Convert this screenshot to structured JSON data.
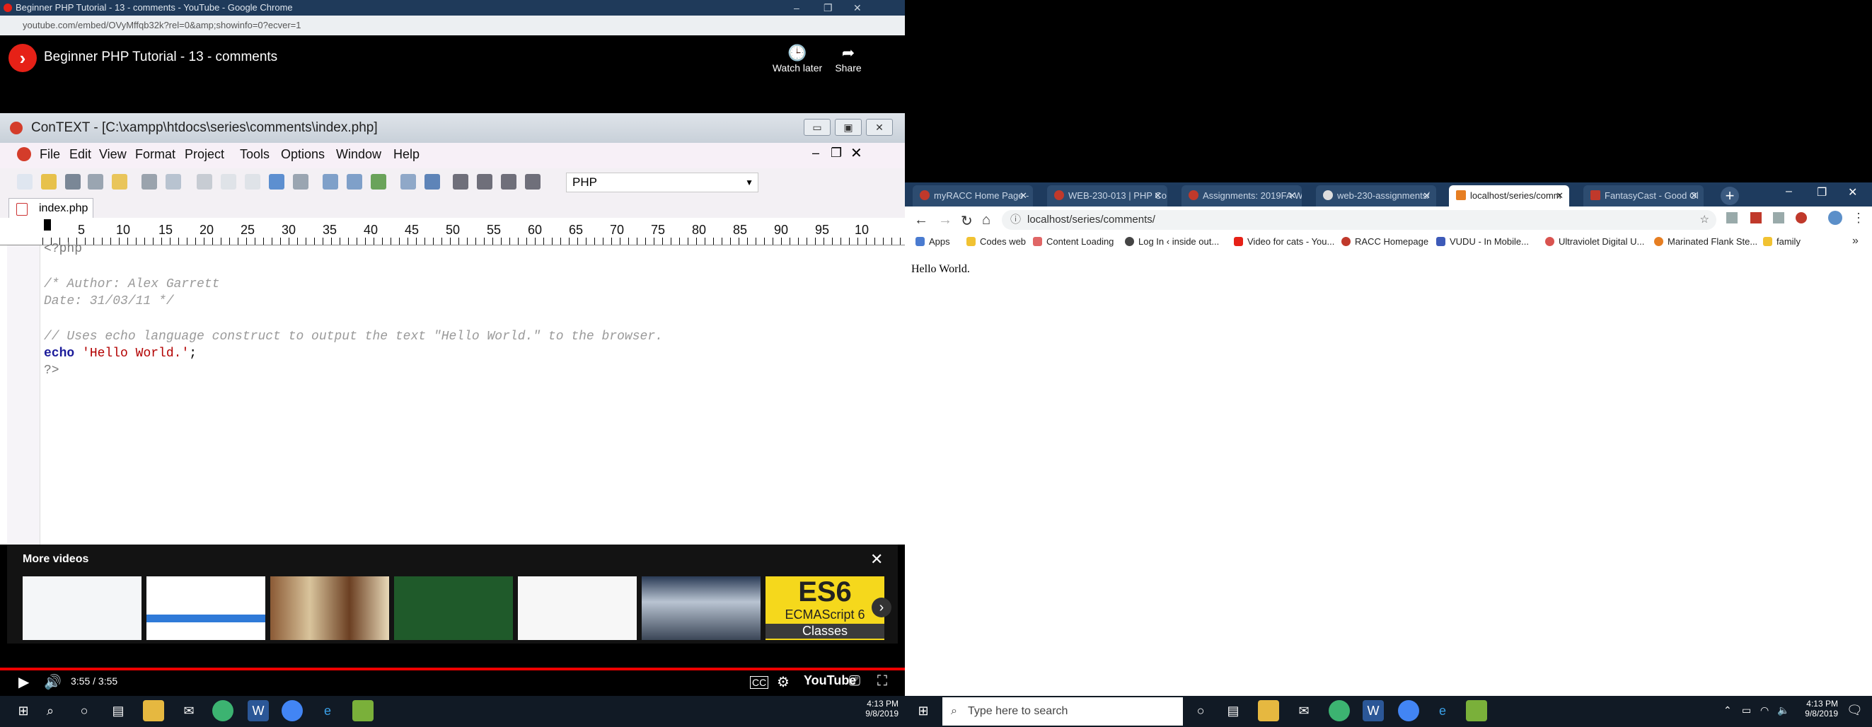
{
  "left_window": {
    "title": "Beginner PHP Tutorial - 13 - comments - YouTube - Google Chrome",
    "url": "youtube.com/embed/OVyMffqb32k?rel=0&amp;showinfo=0?ecver=1",
    "video_title": "Beginner PHP Tutorial - 13 - comments",
    "watch_later": "Watch later",
    "share": "Share"
  },
  "context": {
    "title": "ConTEXT - [C:\\xampp\\htdocs\\series\\comments\\index.php]",
    "menu": [
      "File",
      "Edit",
      "View",
      "Format",
      "Project",
      "Tools",
      "Options",
      "Window",
      "Help"
    ],
    "language": "PHP",
    "tab": "index.php",
    "ruler": [
      "5",
      "10",
      "15",
      "20",
      "25",
      "30",
      "35",
      "40",
      "45",
      "50",
      "55",
      "60",
      "65",
      "70",
      "75",
      "80",
      "85",
      "90",
      "95",
      "10"
    ],
    "code": {
      "l1": "<?php",
      "l2": "/* Author: Alex Garrett",
      "l3": "Date: 31/03/11 */",
      "l4": "// Uses echo language construct to output the text \"Hello World.\" to the browser.",
      "l5_kw": "echo",
      "l5_str": "'Hello World.'",
      "l5_end": ";",
      "l6": "?>"
    }
  },
  "more_videos": {
    "title": "More videos",
    "es6": {
      "big": "ES6",
      "small": "ECMAScript 6",
      "label": "Classes"
    }
  },
  "player": {
    "time": "3:55 / 3:55",
    "brand": "YouTube",
    "progress": 1.0
  },
  "right_window": {
    "tabs": [
      "myRACC Home Page -",
      "WEB-230-013 | PHP Co",
      "Assignments: 2019FA W",
      "web-230-assignments/",
      "localhost/series/comm",
      "FantasyCast - Good Ol"
    ],
    "active_tab": 4,
    "url": "localhost/series/comments/",
    "bookmarks": [
      "Apps",
      "Codes web",
      "Content Loading",
      "Log In ‹ inside out...",
      "Video for cats - You...",
      "RACC Homepage",
      "VUDU - In Mobile...",
      "Ultraviolet Digital U...",
      "Marinated Flank Ste...",
      "family"
    ],
    "page_text": "Hello World."
  },
  "taskbar_left": {
    "time": "4:13 PM",
    "date": "9/8/2019"
  },
  "taskbar_right": {
    "search": "Type here to search",
    "time": "4:13 PM",
    "date": "9/8/2019"
  },
  "colors": {
    "youtube_red": "#e62117",
    "chrome_dark": "#1e3b5e",
    "taskbar": "#111a25"
  }
}
